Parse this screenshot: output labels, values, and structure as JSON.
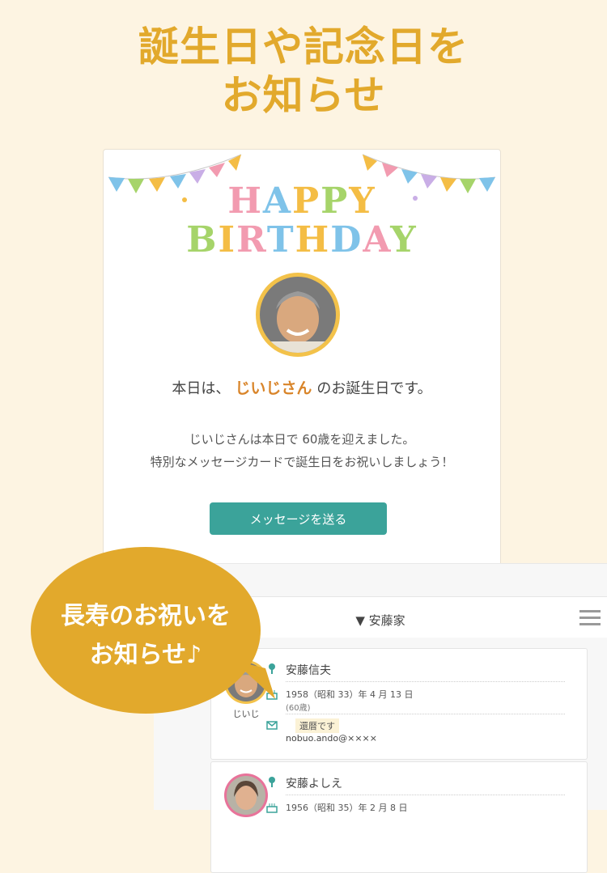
{
  "headline": {
    "line1": "誕生日や記念日を",
    "line2": "お知らせ"
  },
  "card": {
    "happy_line1": [
      "H",
      "A",
      "P",
      "P",
      "Y"
    ],
    "happy_line2": [
      "B",
      "I",
      "R",
      "T",
      "H",
      "D",
      "A",
      "Y"
    ],
    "intro_before": "本日は、",
    "intro_name": "じいじさん",
    "intro_after": "のお誕生日です。",
    "body_line1": "じいじさんは本日で 60歳を迎えました。",
    "body_line2": "特別なメッセージカードで誕生日をお祝いしましょう！",
    "button_label": "メッセージを送る"
  },
  "panel": {
    "family_label": "▼ 安藤家",
    "people": [
      {
        "label": "じいじ",
        "name": "安藤信夫",
        "birthday": "1958（昭和 33）年 4 月 13 日",
        "age": "(60歳)",
        "tag": "還暦です",
        "email": "nobuo.ando@××××"
      },
      {
        "label": "",
        "name": "安藤よしえ",
        "birthday": "1956（昭和 35）年 2 月 8 日",
        "age": "",
        "tag": "",
        "email": ""
      }
    ]
  },
  "bubble": {
    "line1": "長寿のお祝いを",
    "line2": "お知らせ♪"
  },
  "colors": {
    "accent": "#e2a92c",
    "teal": "#3ba39a",
    "name": "#d9852a",
    "letters": [
      "#f29bb0",
      "#f4bd45",
      "#7fc3e9",
      "#a6d46a"
    ]
  }
}
